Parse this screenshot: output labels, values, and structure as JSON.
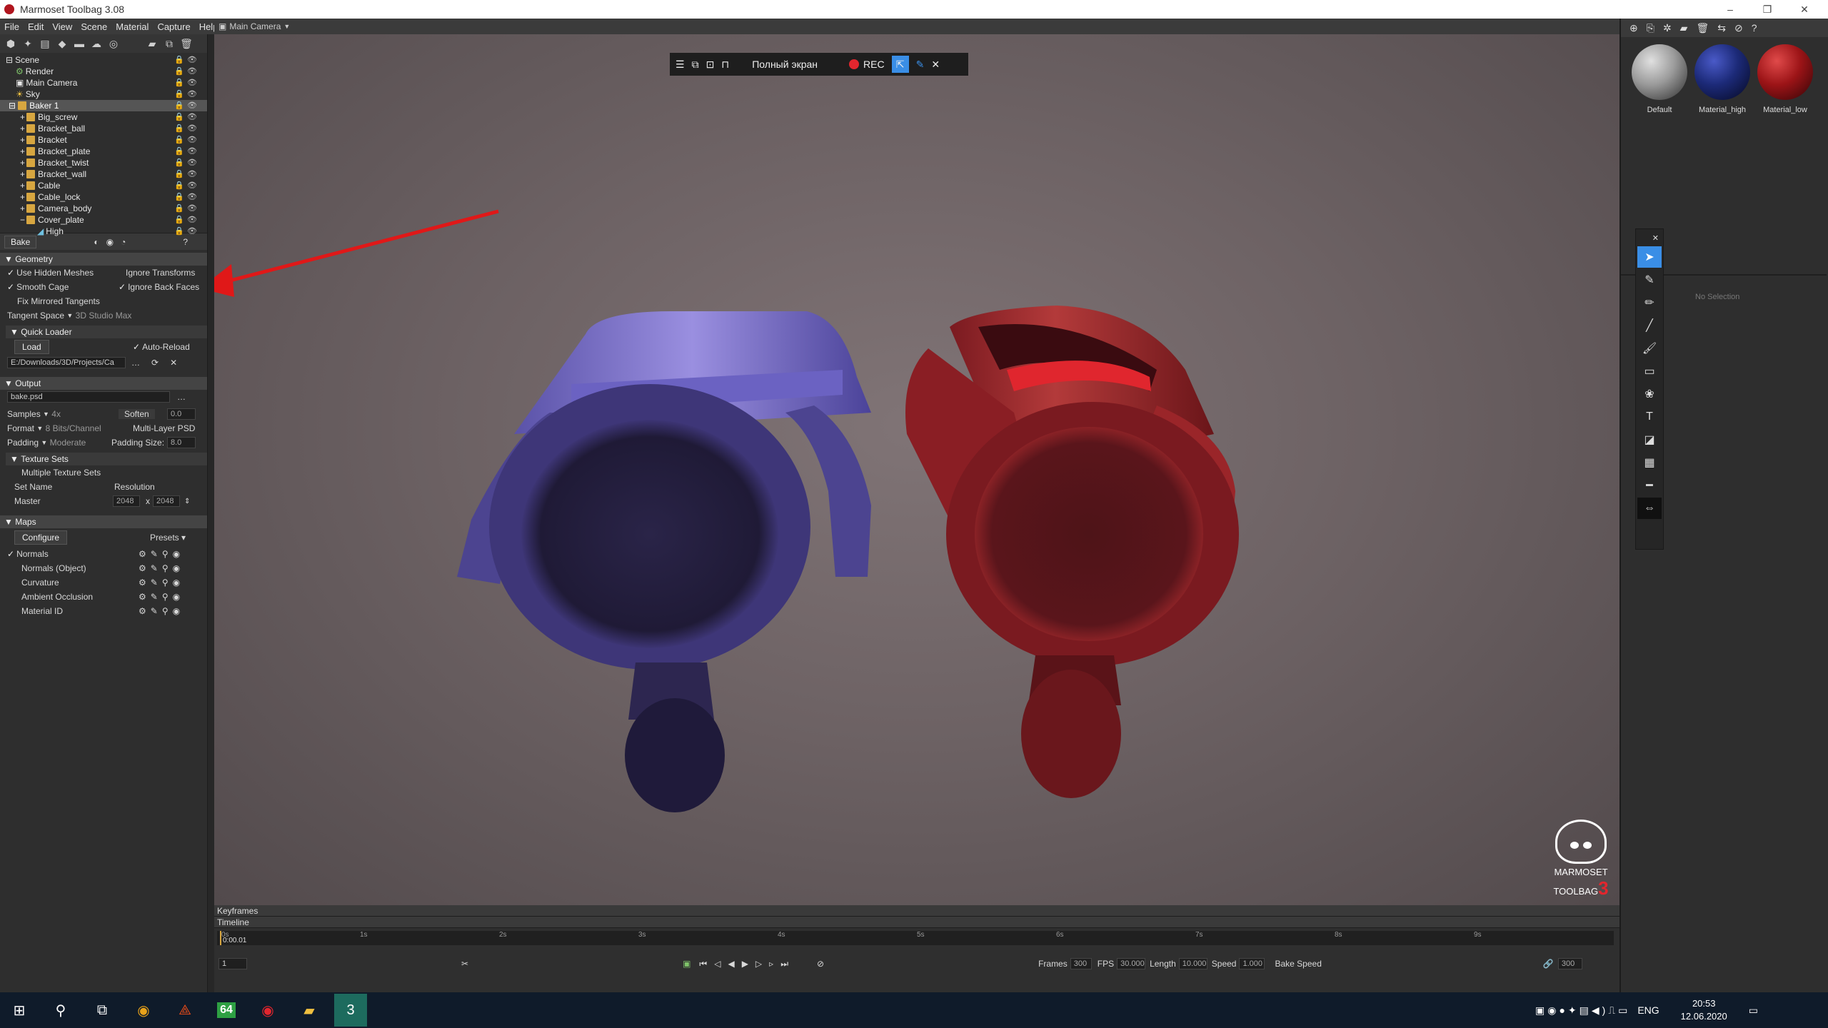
{
  "window": {
    "title": "Marmoset Toolbag 3.08"
  },
  "menu": [
    "File",
    "Edit",
    "View",
    "Scene",
    "Material",
    "Capture",
    "Help"
  ],
  "viewport": {
    "camera_label": "Main Camera"
  },
  "scene_tree": [
    {
      "label": "Scene",
      "depth": 0,
      "folder": false
    },
    {
      "label": "Render",
      "depth": 1,
      "folder": false
    },
    {
      "label": "Main Camera",
      "depth": 1,
      "folder": false
    },
    {
      "label": "Sky",
      "depth": 1,
      "folder": false
    },
    {
      "label": "Baker 1",
      "depth": 1,
      "folder": true,
      "selected": true
    },
    {
      "label": "Big_screw",
      "depth": 2,
      "folder": true
    },
    {
      "label": "Bracket_ball",
      "depth": 2,
      "folder": true
    },
    {
      "label": "Bracket",
      "depth": 2,
      "folder": true
    },
    {
      "label": "Bracket_plate",
      "depth": 2,
      "folder": true
    },
    {
      "label": "Bracket_twist",
      "depth": 2,
      "folder": true
    },
    {
      "label": "Bracket_wall",
      "depth": 2,
      "folder": true
    },
    {
      "label": "Cable",
      "depth": 2,
      "folder": true
    },
    {
      "label": "Cable_lock",
      "depth": 2,
      "folder": true
    },
    {
      "label": "Camera_body",
      "depth": 2,
      "folder": true
    },
    {
      "label": "Cover_plate",
      "depth": 2,
      "folder": true
    },
    {
      "label": "High",
      "depth": 3,
      "folder": false
    }
  ],
  "bake": {
    "tab_label": "Bake",
    "geometry_header": "Geometry",
    "use_hidden_meshes": "Use Hidden Meshes",
    "ignore_transforms": "Ignore Transforms",
    "smooth_cage": "Smooth Cage",
    "ignore_back_faces": "Ignore Back Faces",
    "fix_mirrored": "Fix Mirrored Tangents",
    "tangent_space_label": "Tangent Space",
    "tangent_space_value": "3D Studio Max",
    "quick_loader": "Quick Loader",
    "load_button": "Load",
    "auto_reload": "Auto-Reload",
    "path": "E:/Downloads/3D/Projects/Ca",
    "output_header": "Output",
    "output_file": "bake.psd",
    "samples_label": "Samples",
    "samples_value": "4x",
    "soften_label": "Soften",
    "soften_value": "0.0",
    "format_label": "Format",
    "format_value": "8 Bits/Channel",
    "multilayer": "Multi-Layer PSD",
    "padding_label": "Padding",
    "padding_value": "Moderate",
    "padding_size_label": "Padding Size:",
    "padding_size_value": "8.0",
    "texture_sets": "Texture Sets",
    "multiple_sets": "Multiple Texture Sets",
    "set_name": "Set Name",
    "resolution": "Resolution",
    "master": "Master",
    "res_w": "2048",
    "res_x": "x",
    "res_h": "2048",
    "maps_header": "Maps",
    "configure": "Configure",
    "presets": "Presets",
    "maps": [
      "Normals",
      "Normals (Object)",
      "Curvature",
      "Ambient Occlusion",
      "Material ID"
    ]
  },
  "recorder": {
    "fullscreen": "Полный экран",
    "rec": "REC"
  },
  "materials": [
    {
      "label": "Default",
      "color": "#9a9a9a"
    },
    {
      "label": "Material_high",
      "color": "#1c2a78"
    },
    {
      "label": "Material_low",
      "color": "#9c1417"
    }
  ],
  "selection": "No Selection",
  "logo": {
    "line1": "MARMOSET",
    "line2": "TOOLBAG",
    "num": "3"
  },
  "timeline": {
    "keyframes": "Keyframes",
    "timeline": "Timeline",
    "time": "0:00.01",
    "frame": "1",
    "ticks": [
      "0s",
      "1s",
      "2s",
      "3s",
      "4s",
      "5s",
      "6s",
      "7s",
      "8s",
      "9s"
    ],
    "frames_label": "Frames",
    "frames_value": "300",
    "fps_label": "FPS",
    "fps_value": "30.000",
    "length_label": "Length",
    "length_value": "10.000",
    "speed_label": "Speed",
    "speed_value": "1.000",
    "bake_speed": "Bake Speed",
    "end_frame": "300"
  },
  "taskbar": {
    "lang": "ENG",
    "time": "20:53",
    "date": "12.06.2020",
    "badge": "64"
  }
}
